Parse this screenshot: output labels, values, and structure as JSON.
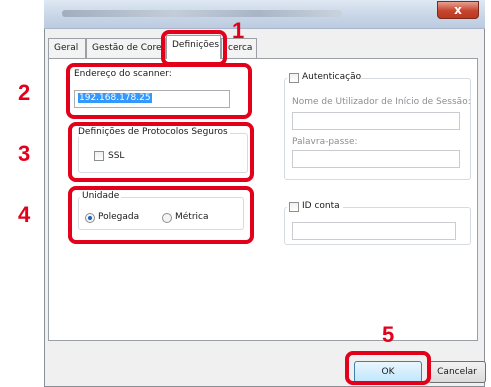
{
  "window": {
    "close_glyph": "x"
  },
  "tabs": [
    {
      "label": "Geral"
    },
    {
      "label": "Gestão de Core"
    },
    {
      "label": "Definições",
      "selected": true
    },
    {
      "label": "cerca"
    }
  ],
  "scanner": {
    "label": "Endereço do scanner:",
    "value": "192.168.178.25"
  },
  "protocols": {
    "legend": "Definições de Protocolos Seguros",
    "ssl_label": "SSL",
    "ssl_checked": false
  },
  "unit": {
    "legend": "Unidade",
    "options": [
      {
        "label": "Polegada",
        "selected": true
      },
      {
        "label": "Métrica",
        "selected": false
      }
    ]
  },
  "auth": {
    "label": "Autenticação",
    "checked": false,
    "username_label": "Nome de Utilizador de Início de Sessão:",
    "password_label": "Palavra-passe:"
  },
  "account": {
    "label": "ID conta",
    "checked": false
  },
  "buttons": {
    "ok": "OK",
    "cancel": "Cancelar"
  },
  "callouts": [
    "1",
    "2",
    "3",
    "4",
    "5"
  ],
  "colors": {
    "highlight": "#e2001a",
    "selection": "#3399ff"
  }
}
